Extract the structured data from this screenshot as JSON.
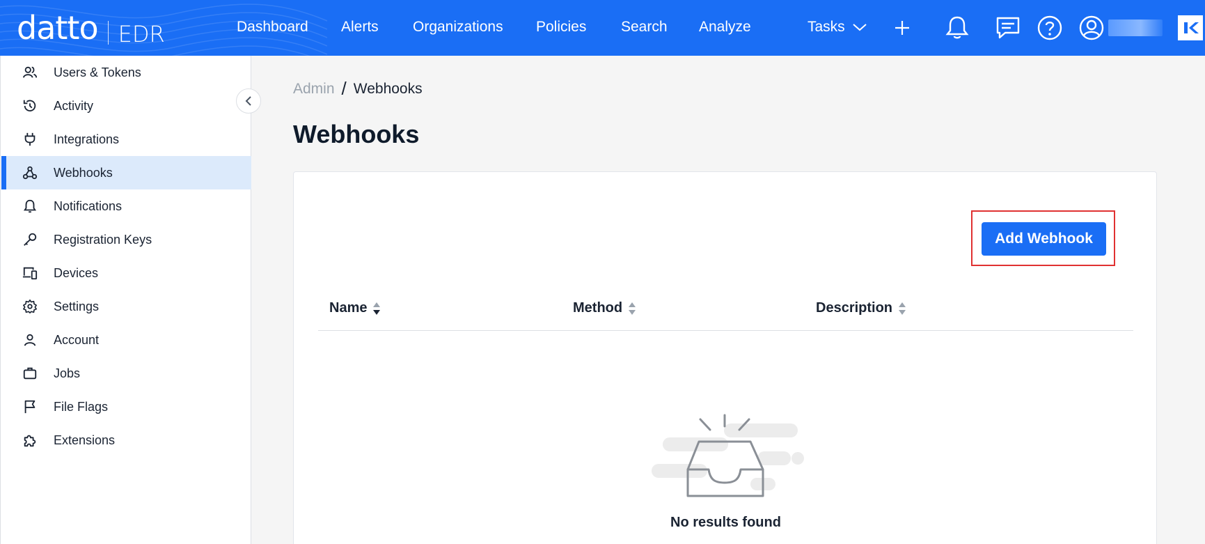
{
  "brand": {
    "logo": "datto",
    "product": "EDR"
  },
  "nav": {
    "items": [
      "Dashboard",
      "Alerts",
      "Organizations",
      "Policies",
      "Search",
      "Analyze"
    ],
    "tasks": "Tasks"
  },
  "sidebar": {
    "items": [
      {
        "label": "Users & Tokens",
        "icon": "users-icon"
      },
      {
        "label": "Activity",
        "icon": "history-icon"
      },
      {
        "label": "Integrations",
        "icon": "plug-icon"
      },
      {
        "label": "Webhooks",
        "icon": "webhook-icon",
        "active": true
      },
      {
        "label": "Notifications",
        "icon": "bell-icon"
      },
      {
        "label": "Registration Keys",
        "icon": "key-icon"
      },
      {
        "label": "Devices",
        "icon": "devices-icon"
      },
      {
        "label": "Settings",
        "icon": "gear-icon"
      },
      {
        "label": "Account",
        "icon": "user-icon"
      },
      {
        "label": "Jobs",
        "icon": "briefcase-icon"
      },
      {
        "label": "File Flags",
        "icon": "flag-icon"
      },
      {
        "label": "Extensions",
        "icon": "puzzle-icon"
      }
    ]
  },
  "breadcrumb": {
    "root": "Admin",
    "separator": "/",
    "current": "Webhooks"
  },
  "page": {
    "title": "Webhooks"
  },
  "actions": {
    "add_webhook": "Add Webhook"
  },
  "table": {
    "columns": [
      "Name",
      "Method",
      "Description"
    ],
    "rows": [],
    "empty_text": "No results found"
  },
  "colors": {
    "accent": "#1a6ef5",
    "highlight": "#e03131",
    "active_bg": "#dceafb"
  }
}
